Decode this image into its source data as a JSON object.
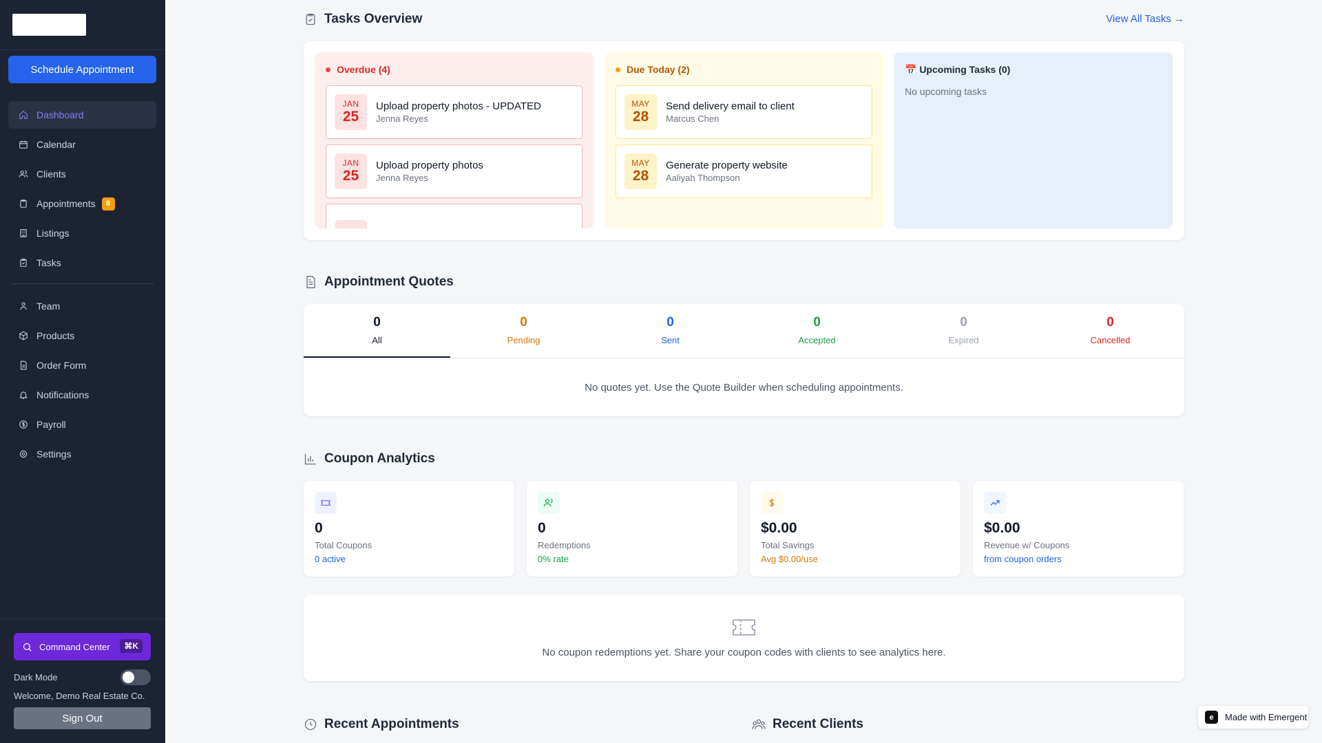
{
  "sidebar": {
    "schedule_button": "Schedule Appointment",
    "nav": [
      {
        "label": "Dashboard",
        "icon": "home-icon",
        "active": true
      },
      {
        "label": "Calendar",
        "icon": "calendar-icon"
      },
      {
        "label": "Clients",
        "icon": "users-icon"
      },
      {
        "label": "Appointments",
        "icon": "clipboard-icon",
        "badge": "8"
      },
      {
        "label": "Listings",
        "icon": "building-icon"
      },
      {
        "label": "Tasks",
        "icon": "clipboard-check-icon"
      },
      {
        "label": "Team",
        "icon": "user-group-icon"
      },
      {
        "label": "Products",
        "icon": "package-icon"
      },
      {
        "label": "Order Form",
        "icon": "document-icon"
      },
      {
        "label": "Notifications",
        "icon": "bell-icon"
      },
      {
        "label": "Payroll",
        "icon": "dollar-circle-icon"
      },
      {
        "label": "Settings",
        "icon": "gear-icon"
      }
    ],
    "command_center": "Command Center",
    "command_shortcut": "⌘K",
    "dark_mode_label": "Dark Mode",
    "welcome": "Welcome, Demo Real Estate Co.",
    "sign_out": "Sign Out"
  },
  "tasks": {
    "title": "Tasks Overview",
    "view_all": "View All Tasks →",
    "overdue": {
      "title": "Overdue (4)",
      "items": [
        {
          "month": "JAN",
          "day": "25",
          "title": "Upload property photos - UPDATED",
          "person": "Jenna Reyes"
        },
        {
          "month": "JAN",
          "day": "25",
          "title": "Upload property photos",
          "person": "Jenna Reyes"
        }
      ]
    },
    "due_today": {
      "title": "Due Today (2)",
      "items": [
        {
          "month": "MAY",
          "day": "28",
          "title": "Send delivery email to client",
          "person": "Marcus Chen"
        },
        {
          "month": "MAY",
          "day": "28",
          "title": "Generate property website",
          "person": "Aaliyah Thompson"
        }
      ]
    },
    "upcoming": {
      "title": "📅 Upcoming Tasks (0)",
      "empty": "No upcoming tasks"
    }
  },
  "quotes": {
    "title": "Appointment Quotes",
    "tabs": [
      {
        "count": "0",
        "label": "All",
        "color": "#111827"
      },
      {
        "count": "0",
        "label": "Pending",
        "color": "#d97706"
      },
      {
        "count": "0",
        "label": "Sent",
        "color": "#2563eb"
      },
      {
        "count": "0",
        "label": "Accepted",
        "color": "#16a34a"
      },
      {
        "count": "0",
        "label": "Expired",
        "color": "#9ca3af"
      },
      {
        "count": "0",
        "label": "Cancelled",
        "color": "#dc2626"
      }
    ],
    "empty": "No quotes yet. Use the Quote Builder when scheduling appointments."
  },
  "coupons": {
    "title": "Coupon Analytics",
    "stats": [
      {
        "value": "0",
        "label": "Total Coupons",
        "sub": "0 active",
        "sub_color": "#2563eb",
        "icon": "ticket-icon",
        "icon_bg": "#eef2ff",
        "icon_color": "#6366f1"
      },
      {
        "value": "0",
        "label": "Redemptions",
        "sub": "0% rate",
        "sub_color": "#16a34a",
        "icon": "users-icon",
        "icon_bg": "#ecfdf5",
        "icon_color": "#16a34a"
      },
      {
        "value": "$0.00",
        "label": "Total Savings",
        "sub": "Avg $0.00/use",
        "sub_color": "#d97706",
        "icon": "dollar-icon",
        "icon_bg": "#fffbeb",
        "icon_color": "#d97706"
      },
      {
        "value": "$0.00",
        "label": "Revenue w/ Coupons",
        "sub": "from coupon orders",
        "sub_color": "#2563eb",
        "icon": "trending-up-icon",
        "icon_bg": "#eff6ff",
        "icon_color": "#2563eb"
      }
    ],
    "empty": "No coupon redemptions yet. Share your coupon codes with clients to see analytics here."
  },
  "recent_appointments": {
    "title": "Recent Appointments"
  },
  "recent_clients": {
    "title": "Recent Clients"
  },
  "badge": {
    "label": "Made with Emergent"
  }
}
